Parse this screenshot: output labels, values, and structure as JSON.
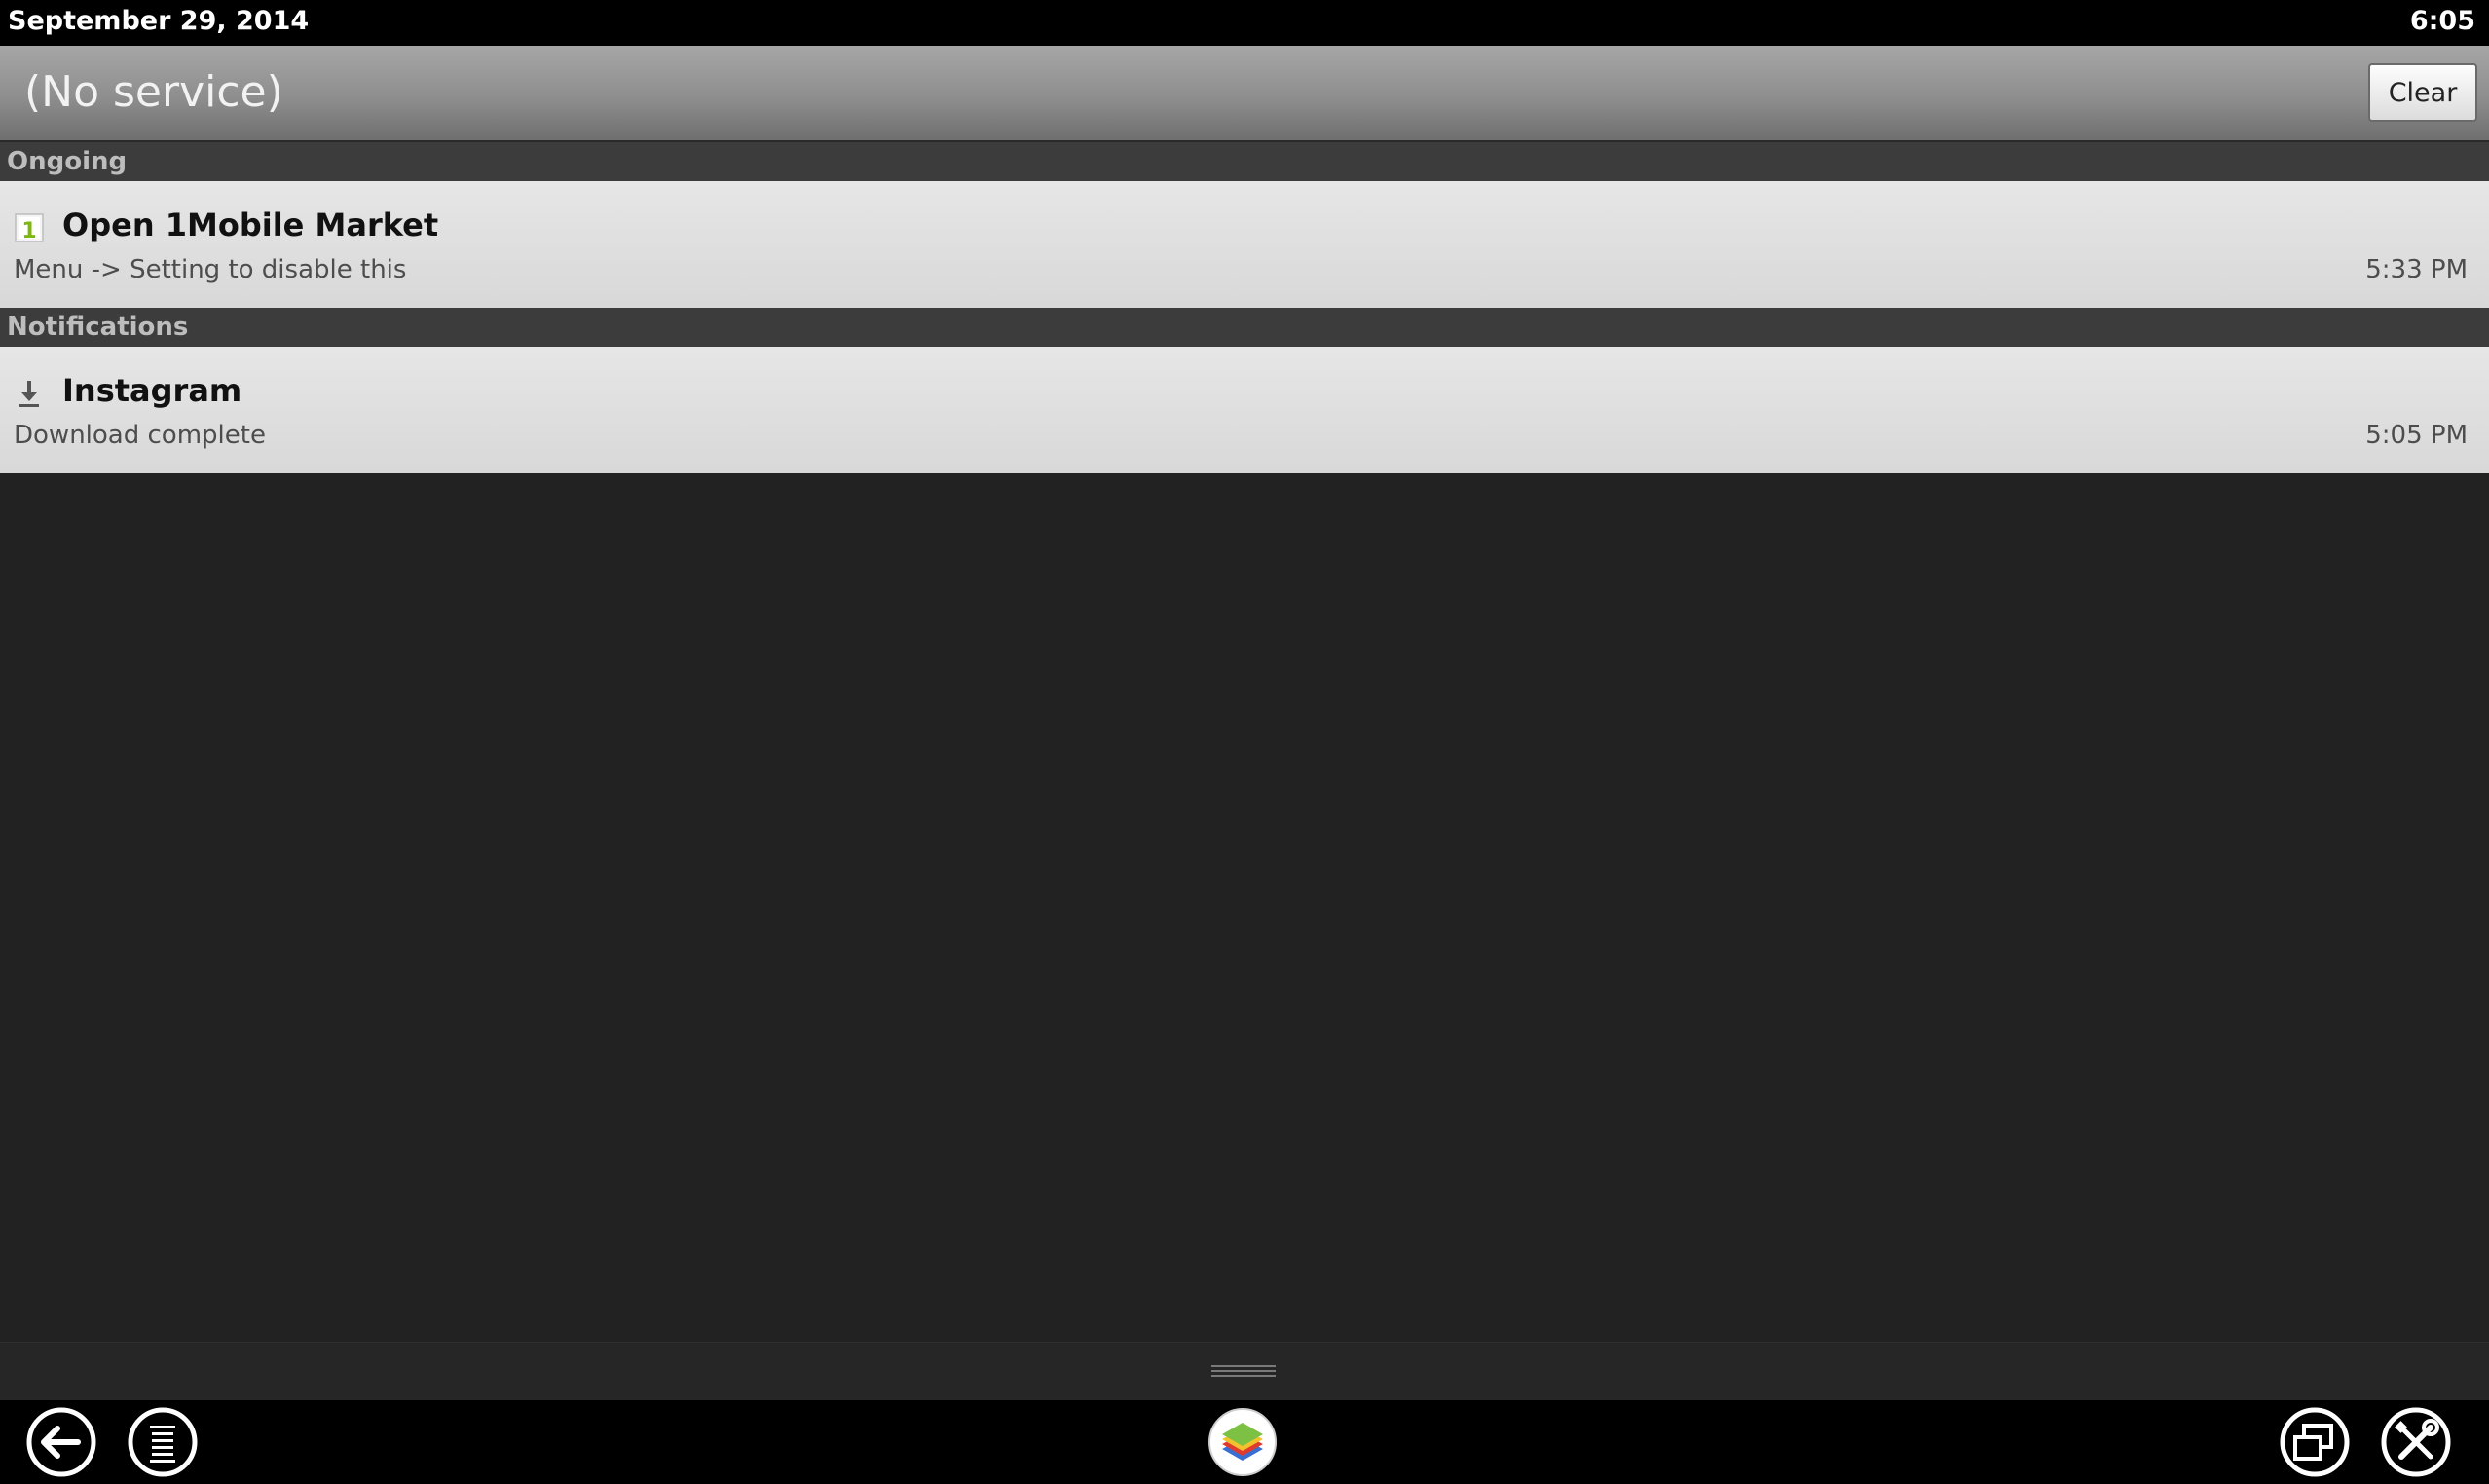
{
  "status_bar": {
    "date": "September 29, 2014",
    "time": "6:05"
  },
  "header": {
    "title": "(No service)",
    "clear_label": "Clear"
  },
  "sections": {
    "ongoing": {
      "label": "Ongoing",
      "items": [
        {
          "icon": "1mobile-market-icon",
          "title": "Open 1Mobile Market",
          "text": "Menu -> Setting to disable this",
          "time": "5:33 PM"
        }
      ]
    },
    "notifications": {
      "label": "Notifications",
      "items": [
        {
          "icon": "download-icon",
          "title": "Instagram",
          "text": "Download complete",
          "time": "5:05 PM"
        }
      ]
    }
  },
  "nav_bar": {
    "buttons": [
      "back-icon",
      "menu-icon",
      "bluestacks-home-icon",
      "window-resize-icon",
      "settings-tools-icon"
    ]
  },
  "colors": {
    "status_bar_bg": "#000000",
    "background": "#222222",
    "item_bg": "#e0e0e0",
    "section_bg": "#3c3c3c"
  }
}
